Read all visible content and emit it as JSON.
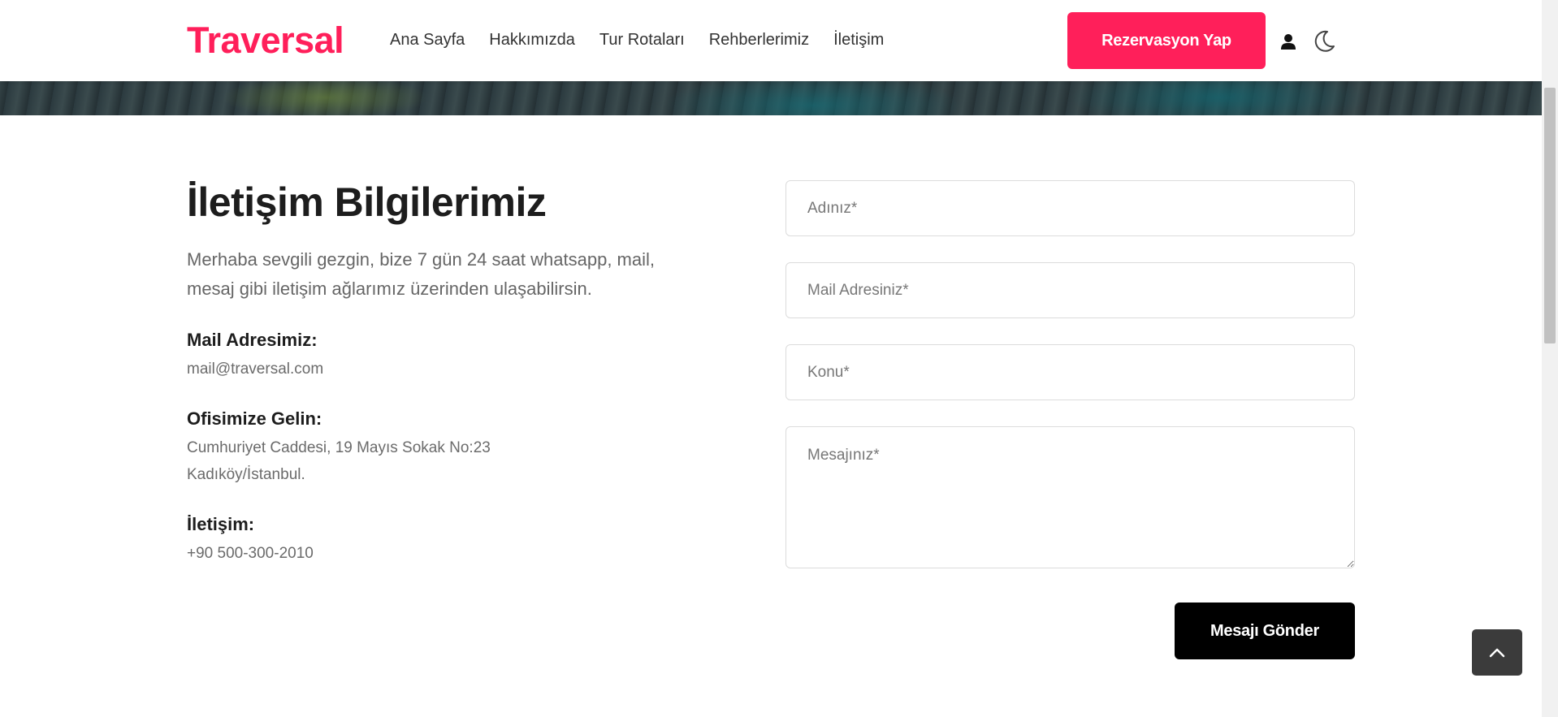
{
  "header": {
    "logo": "Traversal",
    "nav": [
      "Ana Sayfa",
      "Hakkımızda",
      "Tur Rotaları",
      "Rehberlerimiz",
      "İletişim"
    ],
    "reservation_button": "Rezervasyon Yap"
  },
  "contact_info": {
    "title": "İletişim Bilgilerimiz",
    "intro": "Merhaba sevgili gezgin, bize 7 gün 24 saat whatsapp, mail, mesaj gibi iletişim ağlarımız üzerinden ulaşabilirsin.",
    "mail_label": "Mail Adresimiz:",
    "mail_value": "mail@traversal.com",
    "office_label": "Ofisimize Gelin:",
    "office_line1": "Cumhuriyet Caddesi, 19 Mayıs Sokak No:23",
    "office_line2": "Kadıköy/İstanbul.",
    "phone_label": "İletişim:",
    "phone_value": "+90 500-300-2010"
  },
  "form": {
    "name_placeholder": "Adınız*",
    "email_placeholder": "Mail Adresiniz*",
    "subject_placeholder": "Konu*",
    "message_placeholder": "Mesajınız*",
    "submit_label": "Mesajı Gönder"
  },
  "icons": {
    "user": "user-icon",
    "theme": "moon-icon",
    "scroll_top": "chevron-up-icon"
  },
  "colors": {
    "brand": "#ff1f5a",
    "submit": "#000000"
  }
}
